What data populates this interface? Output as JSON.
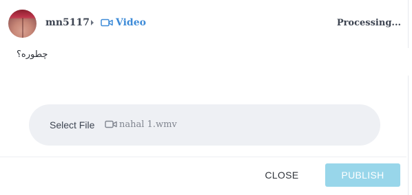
{
  "post": {
    "author": "mn5117",
    "type_label": "Video",
    "type_icon": "video-camera-icon",
    "status": "Processing...",
    "text": "چطوره؟"
  },
  "file": {
    "select_label": "Select File",
    "file_icon": "video-camera-icon",
    "file_name": "nahal 1.wmv"
  },
  "actions": {
    "close_label": "CLOSE",
    "publish_label": "PUBLISH",
    "publish_enabled": false
  },
  "colors": {
    "accent": "#3d8bd8",
    "publish_disabled_bg": "#98d6ea",
    "file_bar_bg": "#eef0f4",
    "text_dark": "#3d4451"
  }
}
